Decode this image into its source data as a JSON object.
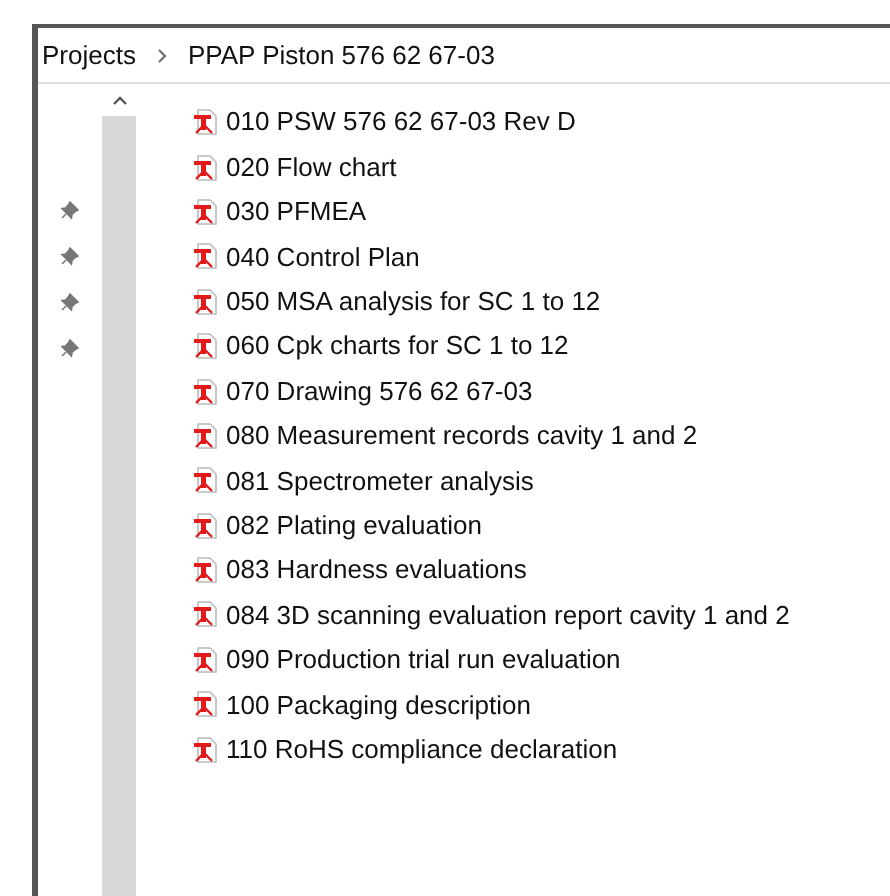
{
  "breadcrumb": [
    {
      "label": "Projects"
    },
    {
      "label": "PPAP Piston 576 62 67-03"
    }
  ],
  "pins": [
    {
      "pinned": true
    },
    {
      "pinned": true
    },
    {
      "pinned": true
    },
    {
      "pinned": true
    }
  ],
  "files": [
    {
      "name": "010 PSW 576 62 67-03 Rev D",
      "kind": "pdf"
    },
    {
      "name": "020 Flow chart",
      "kind": "pdf"
    },
    {
      "name": "030 PFMEA",
      "kind": "pdf"
    },
    {
      "name": "040 Control Plan",
      "kind": "pdf"
    },
    {
      "name": "050 MSA analysis for SC 1 to 12",
      "kind": "pdf"
    },
    {
      "name": "060 Cpk charts for SC 1 to 12",
      "kind": "pdf"
    },
    {
      "name": "070 Drawing 576 62 67-03",
      "kind": "pdf"
    },
    {
      "name": "080 Measurement records cavity 1 and 2",
      "kind": "pdf"
    },
    {
      "name": "081 Spectrometer analysis",
      "kind": "pdf"
    },
    {
      "name": "082 Plating evaluation",
      "kind": "pdf"
    },
    {
      "name": "083 Hardness evaluations",
      "kind": "pdf"
    },
    {
      "name": "084 3D scanning evaluation report cavity 1 and 2",
      "kind": "pdf"
    },
    {
      "name": "090 Production trial run evaluation",
      "kind": "pdf"
    },
    {
      "name": "100 Packaging description",
      "kind": "pdf"
    },
    {
      "name": "110 RoHS compliance declaration",
      "kind": "pdf"
    }
  ]
}
